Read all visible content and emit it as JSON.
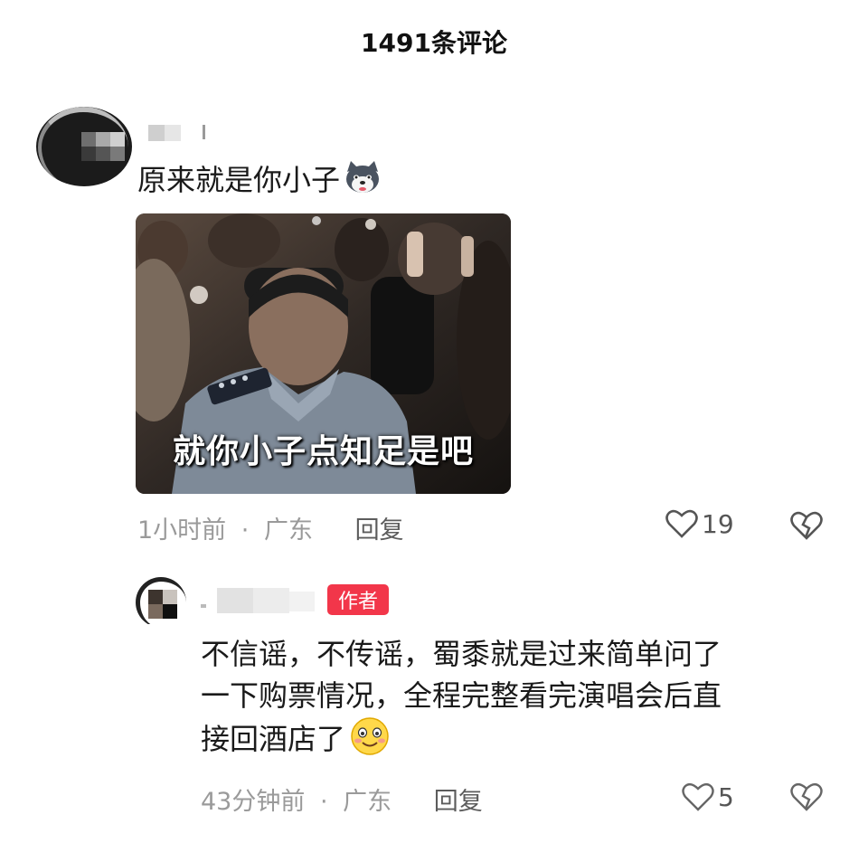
{
  "header": {
    "title": "1491条评论"
  },
  "comment": {
    "text": "原来就是你小子",
    "emoji": "husky-dog-emoji",
    "meme_caption": "就你小子点知足是吧",
    "time": "1小时前",
    "location": "广东",
    "separator": "·",
    "reply_label": "回复",
    "like_count": "19"
  },
  "reply": {
    "badge": "作者",
    "lines": [
      "不信谣，不传谣，蜀黍就是过来简单问了",
      "一下购票情况，全程完整看完演唱会后直",
      "接回酒店了"
    ],
    "emoji": "smiling-face-emoji",
    "time": "43分钟前",
    "location": "广东",
    "separator": "·",
    "reply_label": "回复",
    "like_count": "5"
  },
  "colors": {
    "badge": "#f2364a",
    "meta": "#9a9a9a",
    "text": "#1a1a1a"
  }
}
